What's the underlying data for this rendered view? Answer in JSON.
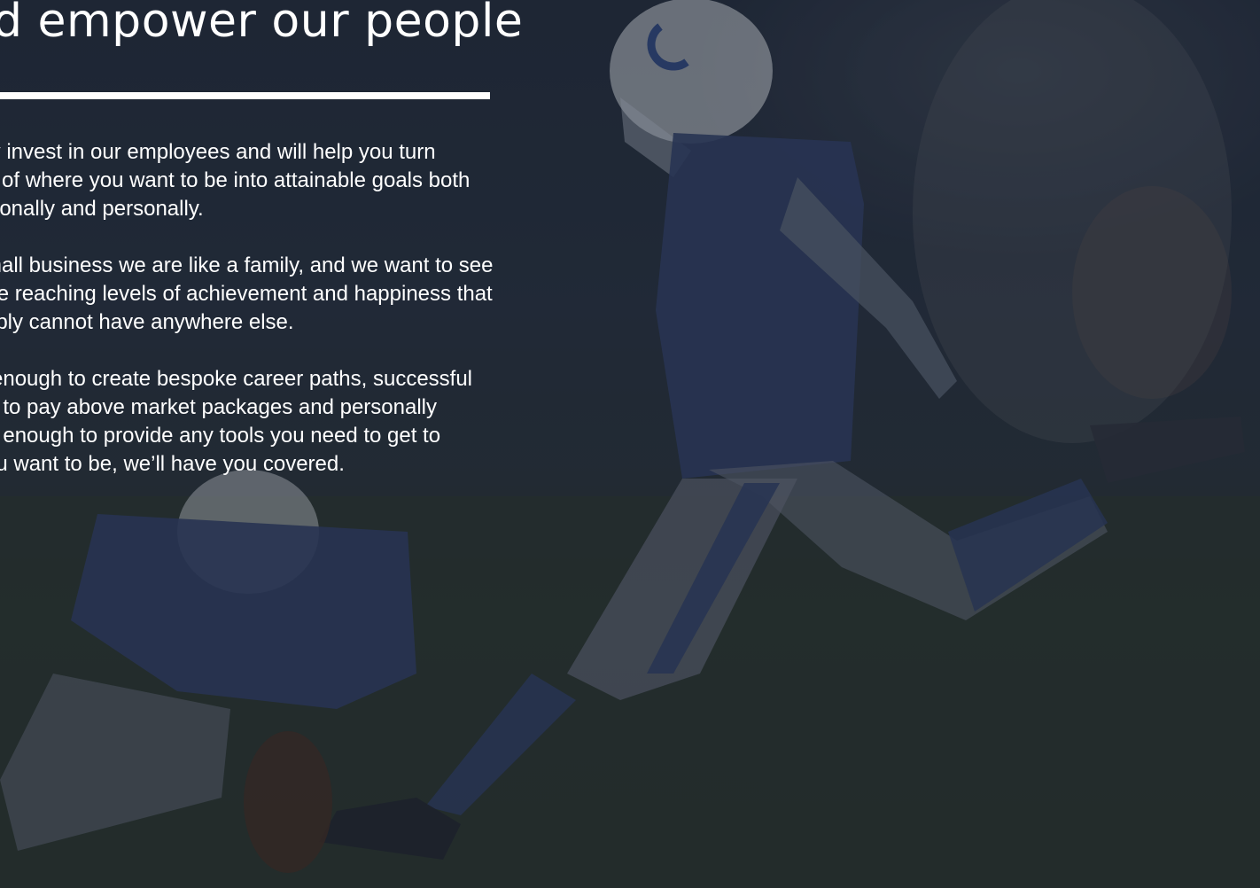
{
  "hero": {
    "heading": "d empower our people",
    "paragraphs": [
      [
        "uly invest in our employees and will help you turn",
        "ns of where you want to be into attainable goals both",
        "ssionally and personally."
      ],
      [
        "small business we are like a family, and we want to see",
        "one reaching levels of achievement and happiness that",
        "imply cannot have anywhere else."
      ],
      [
        "e enough to create bespoke career paths, successful",
        "gh to pay above market packages and personally",
        "ed enough to provide any tools you need to get to",
        "you want to be, we’ll have you covered."
      ]
    ]
  },
  "colors": {
    "text": "#ffffff",
    "background": "#232c3a",
    "uniform_navy": "#2c3a5c",
    "field_green": "#28322f"
  },
  "image": {
    "subject": "football-kicker-photo",
    "icons": [
      "horseshoe-logo-icon"
    ]
  }
}
